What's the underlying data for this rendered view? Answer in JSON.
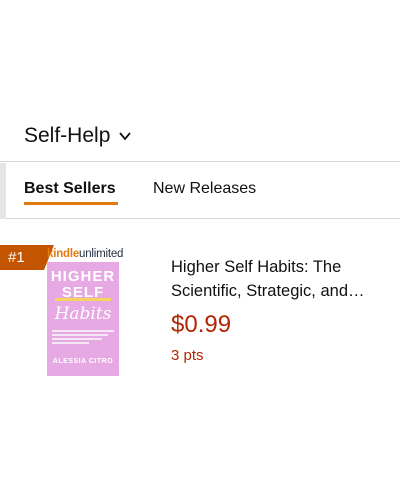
{
  "category": {
    "title": "Self-Help"
  },
  "tabs": [
    {
      "label": "Best Sellers",
      "active": true
    },
    {
      "label": "New Releases",
      "active": false
    }
  ],
  "product": {
    "rank": "#1",
    "badge": {
      "kindle": "kindle",
      "unlimited": "unlimited"
    },
    "cover": {
      "line1": "HIGHER",
      "line2": "SELF",
      "line3": "Habits",
      "author": "ALESSIA CITRO"
    },
    "title_line1": "Higher Self Habits: The",
    "title_line2": "Scientific, Strategic, and…",
    "price": "$0.99",
    "points": "3 pts"
  },
  "colors": {
    "accent": "#e47911",
    "price": "#b12704",
    "rank_badge": "#c45500",
    "cover": "#e6a9e3"
  }
}
